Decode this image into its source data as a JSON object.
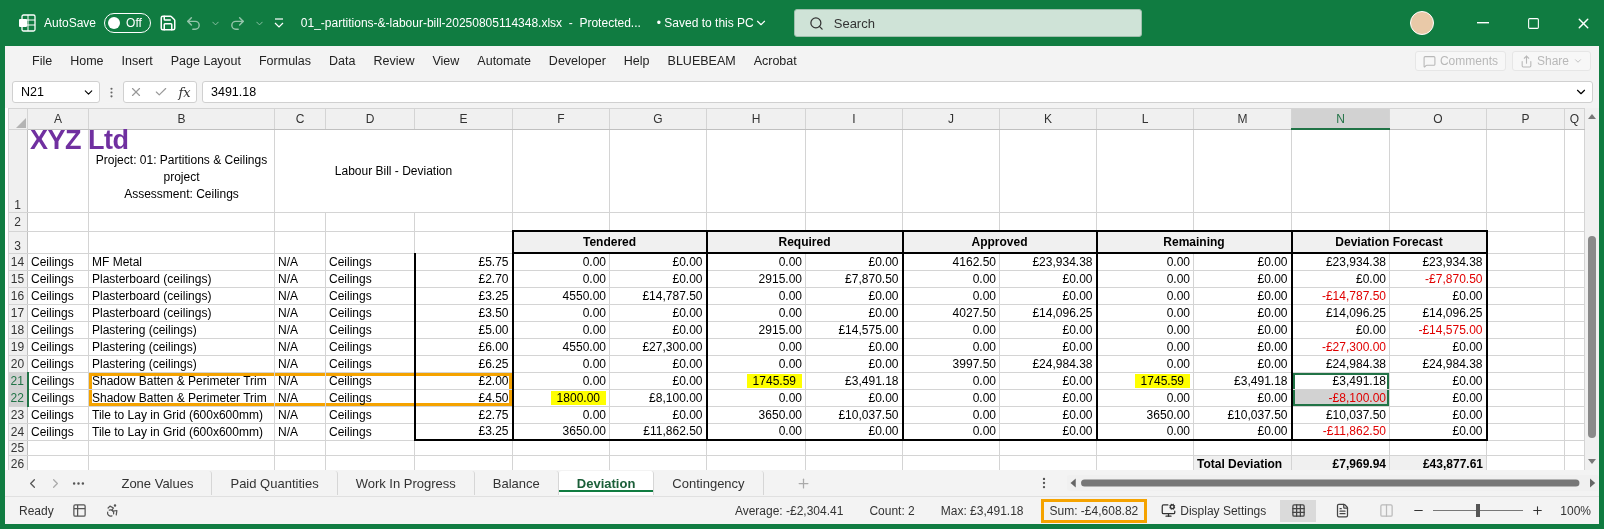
{
  "title_bar": {
    "autosave_label": "AutoSave",
    "autosave": {
      "label": "Off",
      "on": false
    },
    "file_name": "01_-partitions-&-labour-bill-20250805114348.xlsx  -  Protected...",
    "save_status": "• Saved to this PC",
    "search": {
      "placeholder": "Search"
    }
  },
  "ribbon_tabs": [
    "File",
    "Home",
    "Insert",
    "Page Layout",
    "Formulas",
    "Data",
    "Review",
    "View",
    "Automate",
    "Developer",
    "Help",
    "BLUEBEAM",
    "Acrobat"
  ],
  "ribbon_actions": [
    {
      "label": "Comments",
      "kind": "comments",
      "disabled": true
    },
    {
      "label": "Share",
      "kind": "share",
      "disabled": true
    }
  ],
  "formula_bar": {
    "name_box": "N21",
    "fx_label": "fx",
    "formula": "3491.18"
  },
  "columns": [
    {
      "label": "A",
      "selected": false
    },
    {
      "label": "B",
      "selected": false
    },
    {
      "label": "C",
      "selected": false
    },
    {
      "label": "D",
      "selected": false
    },
    {
      "label": "E",
      "selected": false
    },
    {
      "label": "F",
      "selected": false
    },
    {
      "label": "G",
      "selected": false
    },
    {
      "label": "H",
      "selected": false
    },
    {
      "label": "I",
      "selected": false
    },
    {
      "label": "J",
      "selected": false
    },
    {
      "label": "K",
      "selected": false
    },
    {
      "label": "L",
      "selected": false
    },
    {
      "label": "M",
      "selected": false
    },
    {
      "label": "N",
      "selected": true
    },
    {
      "label": "O",
      "selected": false
    },
    {
      "label": "P",
      "selected": false
    },
    {
      "label": "Q",
      "selected": false
    }
  ],
  "rows": [
    {
      "num": "1",
      "kind": "title",
      "selected": false,
      "logo": "XYZ Ltd",
      "project": "Project: 01: Partitions & Ceilings\nproject\nAssessment: Ceilings",
      "heading": "Labour Bill - Deviation"
    },
    {
      "num": "2",
      "kind": "blank",
      "selected": false
    },
    {
      "num": "3",
      "kind": "groups",
      "selected": false,
      "groups": [
        "Tendered",
        "Required",
        "Approved",
        "Remaining",
        "Deviation Forecast"
      ]
    },
    {
      "num": "14",
      "kind": "data",
      "selected": false,
      "outlined": false,
      "cells": [
        "Ceilings",
        "MF Metal",
        "N/A",
        "Ceilings",
        "£5.75",
        "0.00",
        "£0.00",
        "0.00",
        "£0.00",
        "4162.50",
        "£23,934.38",
        "0.00",
        "£0.00",
        "£23,934.38",
        "£23,934.38"
      ]
    },
    {
      "num": "15",
      "kind": "data",
      "selected": false,
      "outlined": false,
      "cells": [
        "Ceilings",
        "Plasterboard (ceilings)",
        "N/A",
        "Ceilings",
        "£2.70",
        "0.00",
        "£0.00",
        "2915.00",
        "£7,870.50",
        "0.00",
        "£0.00",
        "0.00",
        "£0.00",
        "£0.00",
        {
          "text": "-£7,870.50",
          "negative": true
        }
      ]
    },
    {
      "num": "16",
      "kind": "data",
      "selected": false,
      "outlined": false,
      "cells": [
        "Ceilings",
        "Plasterboard (ceilings)",
        "N/A",
        "Ceilings",
        "£3.25",
        "4550.00",
        "£14,787.50",
        "0.00",
        "£0.00",
        "0.00",
        "£0.00",
        "0.00",
        "£0.00",
        {
          "text": "-£14,787.50",
          "negative": true
        },
        "£0.00"
      ]
    },
    {
      "num": "17",
      "kind": "data",
      "selected": false,
      "outlined": false,
      "cells": [
        "Ceilings",
        "Plasterboard (ceilings)",
        "N/A",
        "Ceilings",
        "£3.50",
        "0.00",
        "£0.00",
        "0.00",
        "£0.00",
        "4027.50",
        "£14,096.25",
        "0.00",
        "£0.00",
        "£14,096.25",
        "£14,096.25"
      ]
    },
    {
      "num": "18",
      "kind": "data",
      "selected": false,
      "outlined": false,
      "cells": [
        "Ceilings",
        "Plastering (ceilings)",
        "N/A",
        "Ceilings",
        "£5.00",
        "0.00",
        "£0.00",
        "2915.00",
        "£14,575.00",
        "0.00",
        "£0.00",
        "0.00",
        "£0.00",
        "£0.00",
        {
          "text": "-£14,575.00",
          "negative": true
        }
      ]
    },
    {
      "num": "19",
      "kind": "data",
      "selected": false,
      "outlined": false,
      "cells": [
        "Ceilings",
        "Plastering (ceilings)",
        "N/A",
        "Ceilings",
        "£6.00",
        "4550.00",
        "£27,300.00",
        "0.00",
        "£0.00",
        "0.00",
        "£0.00",
        "0.00",
        "£0.00",
        {
          "text": "-£27,300.00",
          "negative": true
        },
        "£0.00"
      ]
    },
    {
      "num": "20",
      "kind": "data",
      "selected": false,
      "outlined": false,
      "cells": [
        "Ceilings",
        "Plastering (ceilings)",
        "N/A",
        "Ceilings",
        "£6.25",
        "0.00",
        "£0.00",
        "0.00",
        "£0.00",
        "3997.50",
        "£24,984.38",
        "0.00",
        "£0.00",
        "£24,984.38",
        "£24,984.38"
      ]
    },
    {
      "num": "21",
      "kind": "data",
      "selected": true,
      "outlined": true,
      "cells": [
        "Ceilings",
        "Shadow Batten & Perimeter Trim",
        "N/A",
        "Ceilings",
        "£2.00",
        "0.00",
        "£0.00",
        {
          "text": "1745.59",
          "highlight": true
        },
        "£3,491.18",
        "0.00",
        "£0.00",
        {
          "text": "1745.59",
          "highlight": true
        },
        "£3,491.18",
        {
          "text": "£3,491.18",
          "selected": true,
          "active": true
        },
        "£0.00"
      ]
    },
    {
      "num": "22",
      "kind": "data",
      "selected": true,
      "outlined": true,
      "cells": [
        "Ceilings",
        "Shadow Batten & Perimeter Trim",
        "N/A",
        "Ceilings",
        "£4.50",
        {
          "text": "1800.00",
          "highlight": true
        },
        "£8,100.00",
        "0.00",
        "£0.00",
        "0.00",
        "£0.00",
        "0.00",
        "£0.00",
        {
          "text": "-£8,100.00",
          "negative": true,
          "selected": true,
          "active": false
        },
        "£0.00"
      ]
    },
    {
      "num": "23",
      "kind": "data",
      "selected": false,
      "outlined": false,
      "cells": [
        "Ceilings",
        "Tile to Lay in Grid (600x600mm)",
        "N/A",
        "Ceilings",
        "£2.75",
        "0.00",
        "£0.00",
        "3650.00",
        "£10,037.50",
        "0.00",
        "£0.00",
        "3650.00",
        "£10,037.50",
        "£10,037.50",
        "£0.00"
      ]
    },
    {
      "num": "24",
      "kind": "data",
      "selected": false,
      "outlined": false,
      "cells": [
        "Ceilings",
        "Tile to Lay in Grid (600x600mm)",
        "N/A",
        "Ceilings",
        "£3.25",
        "3650.00",
        "£11,862.50",
        "0.00",
        "£0.00",
        "0.00",
        "£0.00",
        "0.00",
        "£0.00",
        {
          "text": "-£11,862.50",
          "negative": true
        },
        "£0.00"
      ]
    },
    {
      "num": "25",
      "kind": "blank",
      "selected": false
    },
    {
      "num": "26",
      "kind": "total",
      "selected": false,
      "label": "Total Deviation",
      "values": [
        "£7,969.94",
        "£43,877.61"
      ]
    }
  ],
  "sheet_tabs": [
    {
      "label": "Zone Values",
      "selected": false
    },
    {
      "label": "Paid Quantities",
      "selected": false
    },
    {
      "label": "Work In Progress",
      "selected": false
    },
    {
      "label": "Balance",
      "selected": false
    },
    {
      "label": "Deviation",
      "selected": true
    },
    {
      "label": "Contingency",
      "selected": false
    }
  ],
  "status_bar": {
    "mode": "Ready",
    "stats": [
      {
        "text": "Average: -£2,304.41",
        "outlined": false
      },
      {
        "text": "Count: 2",
        "outlined": false
      },
      {
        "text": "Max: £3,491.18",
        "outlined": false
      },
      {
        "text": "Sum: -£4,608.82",
        "outlined": true
      }
    ],
    "display_settings": "Display Settings",
    "views": [
      {
        "kind": "normal",
        "selected": true
      },
      {
        "kind": "page_layout",
        "selected": false
      },
      {
        "kind": "page_break",
        "selected": false
      }
    ],
    "zoom": {
      "level": 0.5,
      "reading": "100%"
    }
  }
}
